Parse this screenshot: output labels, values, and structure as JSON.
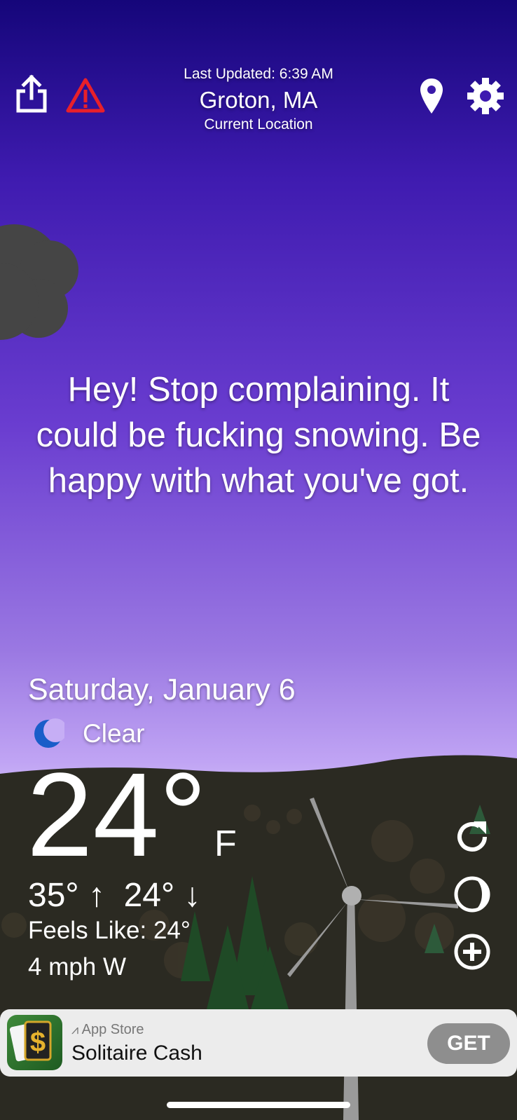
{
  "header": {
    "last_updated": "Last Updated: 6:39 AM",
    "city": "Groton, MA",
    "location_label": "Current Location"
  },
  "quote": "Hey! Stop complaining. It could be fucking snowing. Be happy with what you've got.",
  "weather": {
    "date": "Saturday, January 6",
    "condition": "Clear",
    "condition_icon": "crescent-moon-icon",
    "temperature": "24°",
    "unit": "F",
    "high": "35°",
    "low": "24°",
    "feels_like": "Feels Like: 24°",
    "wind": "4 mph W"
  },
  "icons": {
    "share": "share-icon",
    "alert": "warning-icon",
    "location": "location-pin-icon",
    "settings": "gear-icon",
    "refresh": "refresh-icon",
    "moon_phase": "moon-phase-icon",
    "add": "add-icon"
  },
  "ad": {
    "store_label": "App Store",
    "title": "Solitaire Cash",
    "cta": "GET"
  },
  "colors": {
    "sky_top": "#15067a",
    "sky_bottom": "#c9b2f6",
    "ground": "#2b2a22",
    "alert_red": "#e8202a",
    "moon_blue": "#1a5dc9"
  }
}
